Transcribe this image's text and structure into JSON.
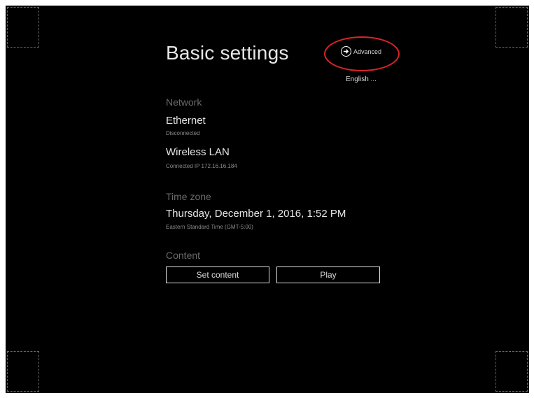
{
  "page": {
    "title": "Basic settings"
  },
  "header": {
    "advanced_label": "Advanced",
    "language_label": "English ..."
  },
  "network": {
    "heading": "Network",
    "ethernet": {
      "label": "Ethernet",
      "status": "Disconnected"
    },
    "wireless": {
      "label": "Wireless LAN",
      "status": "Connected IP 172.16.16.184"
    }
  },
  "timezone": {
    "heading": "Time zone",
    "datetime": "Thursday, December 1, 2016, 1:52 PM",
    "zone": "Eastern Standard Time (GMT-5:00)"
  },
  "content": {
    "heading": "Content",
    "set_content_label": "Set content",
    "play_label": "Play"
  },
  "colors": {
    "background": "#000000",
    "annotation": "#d9242a",
    "text": "#e6e6e6",
    "muted": "#6a6a6a"
  }
}
